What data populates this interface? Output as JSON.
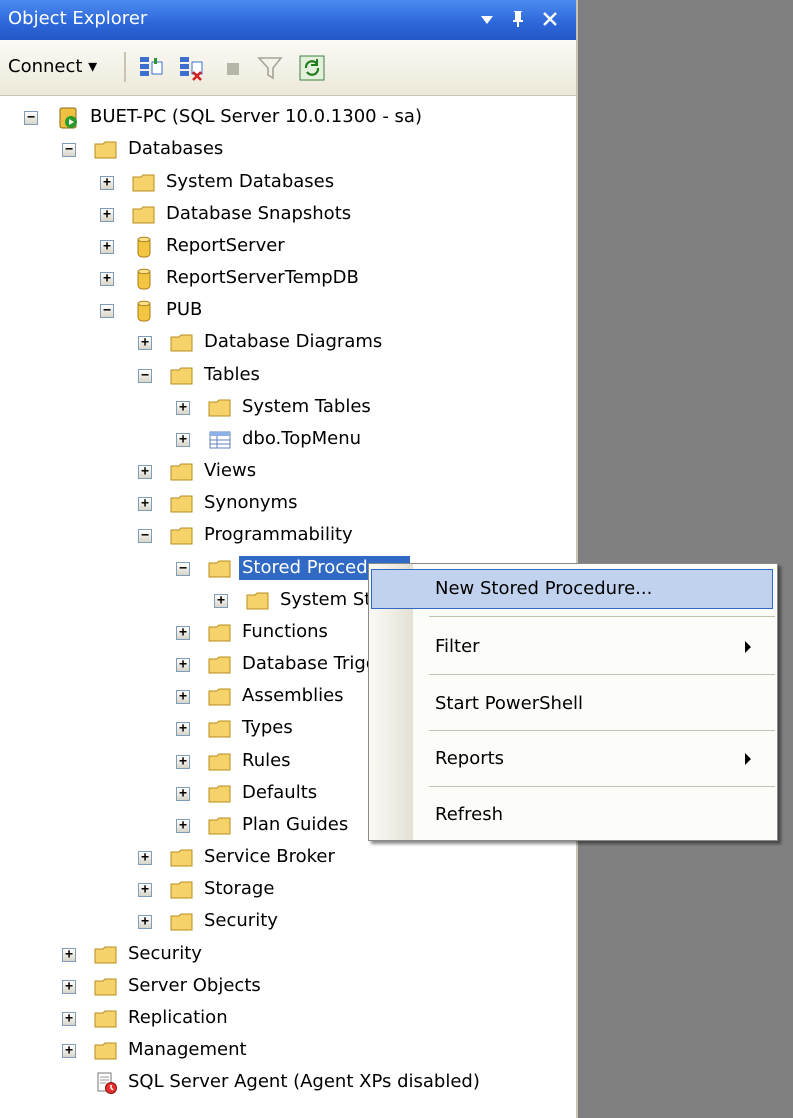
{
  "window": {
    "title": "Object Explorer"
  },
  "toolbar": {
    "connect_label": "Connect ▾"
  },
  "tree": [
    {
      "label": "BUET-PC (SQL Server 10.0.1300 - sa)",
      "icon": "server-icon",
      "state": "expanded"
    },
    {
      "label": "Databases",
      "icon": "folder-icon",
      "state": "expanded"
    },
    {
      "label": "System Databases",
      "icon": "folder-icon",
      "state": "collapsed"
    },
    {
      "label": "Database Snapshots",
      "icon": "folder-icon",
      "state": "collapsed"
    },
    {
      "label": "ReportServer",
      "icon": "database-icon",
      "state": "collapsed"
    },
    {
      "label": "ReportServerTempDB",
      "icon": "database-icon",
      "state": "collapsed"
    },
    {
      "label": "PUB",
      "icon": "database-icon",
      "state": "expanded"
    },
    {
      "label": "Database Diagrams",
      "icon": "folder-icon",
      "state": "collapsed"
    },
    {
      "label": "Tables",
      "icon": "folder-icon",
      "state": "expanded"
    },
    {
      "label": "System Tables",
      "icon": "folder-icon",
      "state": "collapsed"
    },
    {
      "label": "dbo.TopMenu",
      "icon": "table-icon",
      "state": "collapsed"
    },
    {
      "label": "Views",
      "icon": "folder-icon",
      "state": "collapsed"
    },
    {
      "label": "Synonyms",
      "icon": "folder-icon",
      "state": "collapsed"
    },
    {
      "label": "Programmability",
      "icon": "folder-icon",
      "state": "expanded"
    },
    {
      "label": "Stored Procedures",
      "icon": "folder-icon",
      "state": "expanded",
      "selected": true
    },
    {
      "label": "System Stored Procedures",
      "icon": "folder-icon",
      "state": "collapsed"
    },
    {
      "label": "Functions",
      "icon": "folder-icon",
      "state": "collapsed"
    },
    {
      "label": "Database Triggers",
      "icon": "folder-icon",
      "state": "collapsed"
    },
    {
      "label": "Assemblies",
      "icon": "folder-icon",
      "state": "collapsed"
    },
    {
      "label": "Types",
      "icon": "folder-icon",
      "state": "collapsed"
    },
    {
      "label": "Rules",
      "icon": "folder-icon",
      "state": "collapsed"
    },
    {
      "label": "Defaults",
      "icon": "folder-icon",
      "state": "collapsed"
    },
    {
      "label": "Plan Guides",
      "icon": "folder-icon",
      "state": "collapsed"
    },
    {
      "label": "Service Broker",
      "icon": "folder-icon",
      "state": "collapsed"
    },
    {
      "label": "Storage",
      "icon": "folder-icon",
      "state": "collapsed"
    },
    {
      "label": "Security",
      "icon": "folder-icon",
      "state": "collapsed"
    },
    {
      "label": "Security",
      "icon": "folder-icon",
      "state": "collapsed"
    },
    {
      "label": "Server Objects",
      "icon": "folder-icon",
      "state": "collapsed"
    },
    {
      "label": "Replication",
      "icon": "folder-icon",
      "state": "collapsed"
    },
    {
      "label": "Management",
      "icon": "folder-icon",
      "state": "collapsed"
    },
    {
      "label": "SQL Server Agent (Agent XPs disabled)",
      "icon": "agent-icon",
      "state": "leaf"
    }
  ],
  "context_menu": {
    "items": [
      {
        "label": "New Stored Procedure...",
        "highlighted": true,
        "submenu": false
      },
      {
        "label": "Filter",
        "submenu": true
      },
      {
        "label": "Start PowerShell",
        "submenu": false
      },
      {
        "label": "Reports",
        "submenu": true
      },
      {
        "label": "Refresh",
        "submenu": false
      }
    ]
  },
  "colors": {
    "title_bar": "#2c66d9",
    "selection": "#316ac5",
    "menu_highlight": "#c1d2ee",
    "folder": "#f5d26a",
    "background": "#808080"
  }
}
